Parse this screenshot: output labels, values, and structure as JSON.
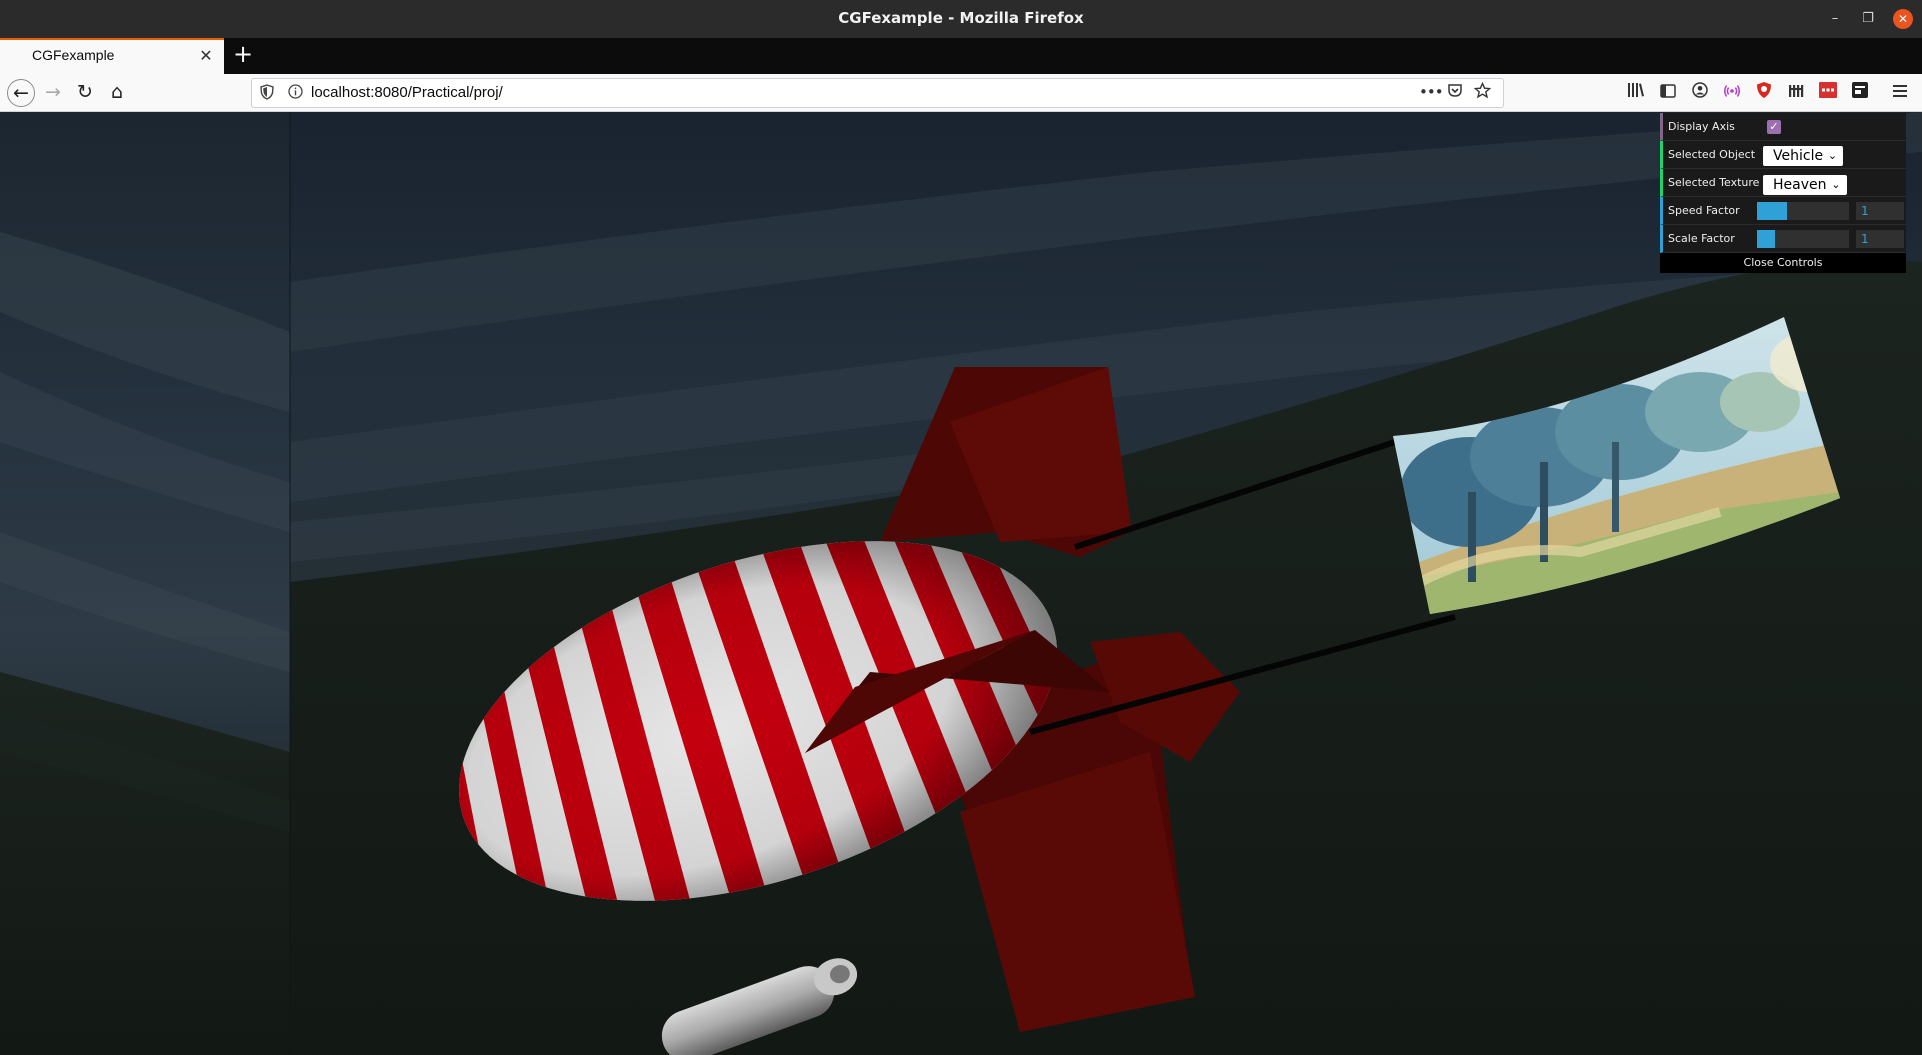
{
  "window": {
    "title": "CGFexample - Mozilla Firefox",
    "minimize_glyph": "–",
    "maximize_glyph": "❐",
    "close_glyph": "✕"
  },
  "tabs": [
    {
      "label": "CGFexample",
      "active": true
    }
  ],
  "newtab_glyph": "+",
  "nav": {
    "url": "localhost:8080/Practical/proj/",
    "back_glyph": "←",
    "forward_glyph": "→",
    "reload_glyph": "↻",
    "home_glyph": "⌂",
    "page_actions_glyph": "•••"
  },
  "toolbar_icons": [
    "library-icon",
    "sidebar-icon",
    "account-icon",
    "extension-icon",
    "adblock-icon",
    "extension-grid-icon",
    "extension-red-icon",
    "extension-dark-icon",
    "menu-icon"
  ],
  "gui": {
    "display_axis": {
      "label": "Display Axis",
      "checked": true,
      "check_glyph": "✓"
    },
    "selected_object": {
      "label": "Selected Object",
      "value": "Vehicle"
    },
    "selected_texture": {
      "label": "Selected Texture",
      "value": "Heaven"
    },
    "speed_factor": {
      "label": "Speed Factor",
      "value": "1",
      "fraction": 0.33
    },
    "scale_factor": {
      "label": "Scale Factor",
      "value": "1",
      "fraction": 0.2
    },
    "close_label": "Close Controls",
    "chevron_glyph": "⌄"
  },
  "colors": {
    "blimp_red": "#c4000e",
    "blimp_white": "#e8e8e8",
    "fin_red": "#5e0a06",
    "gui_accent": "#2fa1d6",
    "tab_accent": "#e66000"
  }
}
